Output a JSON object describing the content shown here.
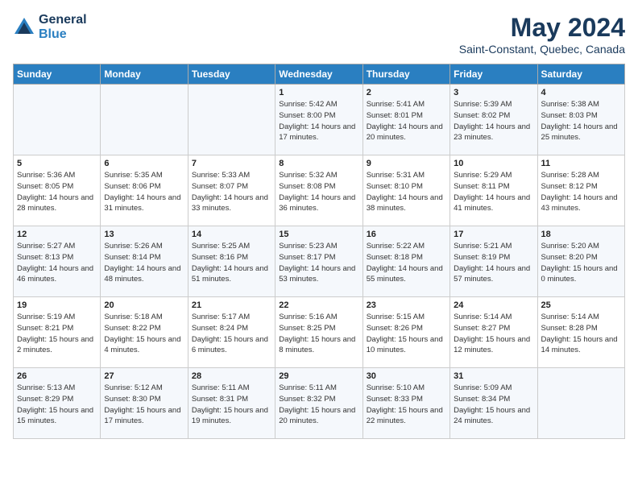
{
  "header": {
    "logo_line1": "General",
    "logo_line2": "Blue",
    "month_title": "May 2024",
    "subtitle": "Saint-Constant, Quebec, Canada"
  },
  "days_of_week": [
    "Sunday",
    "Monday",
    "Tuesday",
    "Wednesday",
    "Thursday",
    "Friday",
    "Saturday"
  ],
  "weeks": [
    [
      {
        "day": "",
        "info": ""
      },
      {
        "day": "",
        "info": ""
      },
      {
        "day": "",
        "info": ""
      },
      {
        "day": "1",
        "info": "Sunrise: 5:42 AM\nSunset: 8:00 PM\nDaylight: 14 hours\nand 17 minutes."
      },
      {
        "day": "2",
        "info": "Sunrise: 5:41 AM\nSunset: 8:01 PM\nDaylight: 14 hours\nand 20 minutes."
      },
      {
        "day": "3",
        "info": "Sunrise: 5:39 AM\nSunset: 8:02 PM\nDaylight: 14 hours\nand 23 minutes."
      },
      {
        "day": "4",
        "info": "Sunrise: 5:38 AM\nSunset: 8:03 PM\nDaylight: 14 hours\nand 25 minutes."
      }
    ],
    [
      {
        "day": "5",
        "info": "Sunrise: 5:36 AM\nSunset: 8:05 PM\nDaylight: 14 hours\nand 28 minutes."
      },
      {
        "day": "6",
        "info": "Sunrise: 5:35 AM\nSunset: 8:06 PM\nDaylight: 14 hours\nand 31 minutes."
      },
      {
        "day": "7",
        "info": "Sunrise: 5:33 AM\nSunset: 8:07 PM\nDaylight: 14 hours\nand 33 minutes."
      },
      {
        "day": "8",
        "info": "Sunrise: 5:32 AM\nSunset: 8:08 PM\nDaylight: 14 hours\nand 36 minutes."
      },
      {
        "day": "9",
        "info": "Sunrise: 5:31 AM\nSunset: 8:10 PM\nDaylight: 14 hours\nand 38 minutes."
      },
      {
        "day": "10",
        "info": "Sunrise: 5:29 AM\nSunset: 8:11 PM\nDaylight: 14 hours\nand 41 minutes."
      },
      {
        "day": "11",
        "info": "Sunrise: 5:28 AM\nSunset: 8:12 PM\nDaylight: 14 hours\nand 43 minutes."
      }
    ],
    [
      {
        "day": "12",
        "info": "Sunrise: 5:27 AM\nSunset: 8:13 PM\nDaylight: 14 hours\nand 46 minutes."
      },
      {
        "day": "13",
        "info": "Sunrise: 5:26 AM\nSunset: 8:14 PM\nDaylight: 14 hours\nand 48 minutes."
      },
      {
        "day": "14",
        "info": "Sunrise: 5:25 AM\nSunset: 8:16 PM\nDaylight: 14 hours\nand 51 minutes."
      },
      {
        "day": "15",
        "info": "Sunrise: 5:23 AM\nSunset: 8:17 PM\nDaylight: 14 hours\nand 53 minutes."
      },
      {
        "day": "16",
        "info": "Sunrise: 5:22 AM\nSunset: 8:18 PM\nDaylight: 14 hours\nand 55 minutes."
      },
      {
        "day": "17",
        "info": "Sunrise: 5:21 AM\nSunset: 8:19 PM\nDaylight: 14 hours\nand 57 minutes."
      },
      {
        "day": "18",
        "info": "Sunrise: 5:20 AM\nSunset: 8:20 PM\nDaylight: 15 hours\nand 0 minutes."
      }
    ],
    [
      {
        "day": "19",
        "info": "Sunrise: 5:19 AM\nSunset: 8:21 PM\nDaylight: 15 hours\nand 2 minutes."
      },
      {
        "day": "20",
        "info": "Sunrise: 5:18 AM\nSunset: 8:22 PM\nDaylight: 15 hours\nand 4 minutes."
      },
      {
        "day": "21",
        "info": "Sunrise: 5:17 AM\nSunset: 8:24 PM\nDaylight: 15 hours\nand 6 minutes."
      },
      {
        "day": "22",
        "info": "Sunrise: 5:16 AM\nSunset: 8:25 PM\nDaylight: 15 hours\nand 8 minutes."
      },
      {
        "day": "23",
        "info": "Sunrise: 5:15 AM\nSunset: 8:26 PM\nDaylight: 15 hours\nand 10 minutes."
      },
      {
        "day": "24",
        "info": "Sunrise: 5:14 AM\nSunset: 8:27 PM\nDaylight: 15 hours\nand 12 minutes."
      },
      {
        "day": "25",
        "info": "Sunrise: 5:14 AM\nSunset: 8:28 PM\nDaylight: 15 hours\nand 14 minutes."
      }
    ],
    [
      {
        "day": "26",
        "info": "Sunrise: 5:13 AM\nSunset: 8:29 PM\nDaylight: 15 hours\nand 15 minutes."
      },
      {
        "day": "27",
        "info": "Sunrise: 5:12 AM\nSunset: 8:30 PM\nDaylight: 15 hours\nand 17 minutes."
      },
      {
        "day": "28",
        "info": "Sunrise: 5:11 AM\nSunset: 8:31 PM\nDaylight: 15 hours\nand 19 minutes."
      },
      {
        "day": "29",
        "info": "Sunrise: 5:11 AM\nSunset: 8:32 PM\nDaylight: 15 hours\nand 20 minutes."
      },
      {
        "day": "30",
        "info": "Sunrise: 5:10 AM\nSunset: 8:33 PM\nDaylight: 15 hours\nand 22 minutes."
      },
      {
        "day": "31",
        "info": "Sunrise: 5:09 AM\nSunset: 8:34 PM\nDaylight: 15 hours\nand 24 minutes."
      },
      {
        "day": "",
        "info": ""
      }
    ]
  ]
}
